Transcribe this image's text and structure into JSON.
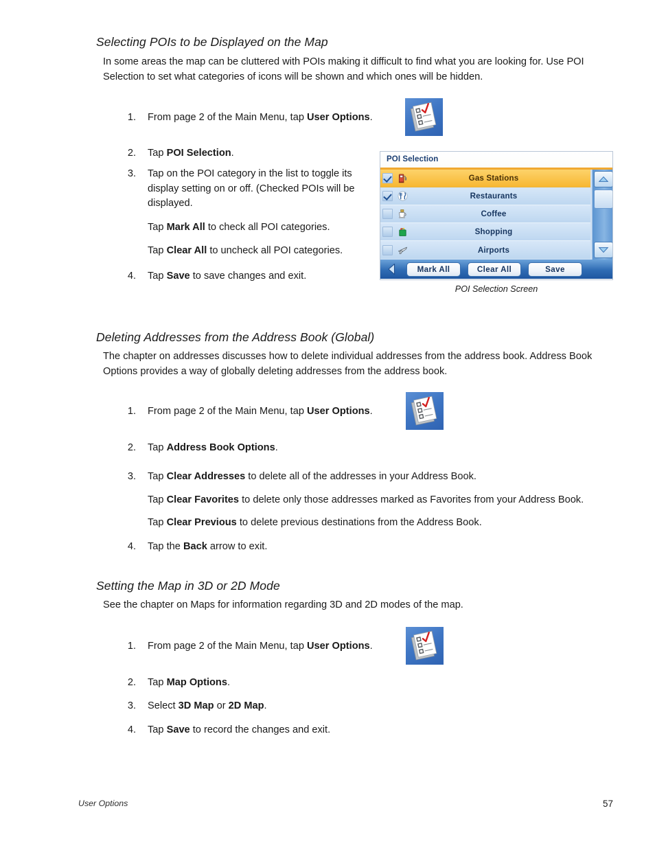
{
  "page": {
    "number": "57",
    "footer_label": "User Options"
  },
  "sections": [
    {
      "heading": "Selecting POIs to be Displayed on the Map",
      "intro": "In some areas the map can be cluttered with POIs making it difficult to find what you are looking for.  Use POI Selection to set what categories of icons will be shown and which ones will be hidden.",
      "steps": {
        "n1": "1.",
        "s1_a": "From page 2 of the Main Menu, tap ",
        "s1_b": "User Options",
        "s1_c": ".",
        "n2": "2.",
        "s2_a": "Tap ",
        "s2_b": "POI Selection",
        "s2_c": ".",
        "n3": "3.",
        "s3_a": "Tap on the POI category in the list to toggle its display setting on or off.  (Checked POIs will be displayed.",
        "s3_sub1_a": "Tap ",
        "s3_sub1_b": "Mark All",
        "s3_sub1_c": " to check all POI categories.",
        "s3_sub2_a": "Tap ",
        "s3_sub2_b": "Clear All",
        "s3_sub2_c": " to uncheck all POI categories.",
        "n4": "4.",
        "s4_a": "Tap ",
        "s4_b": "Save",
        "s4_c": " to save changes and exit."
      }
    },
    {
      "heading": "Deleting Addresses from the Address Book (Global)",
      "intro": "The chapter on addresses discusses how to delete individual addresses from the address book.  Address Book Options provides a way of globally deleting addresses from the address book.",
      "steps": {
        "n1": "1.",
        "s1_a": "From page 2 of the Main Menu, tap ",
        "s1_b": "User Options",
        "s1_c": ".",
        "n2": "2.",
        "s2_a": "Tap ",
        "s2_b": "Address Book Options",
        "s2_c": ".",
        "n3": "3.",
        "s3_a": "Tap ",
        "s3_b": "Clear Addresses",
        "s3_c": " to delete all of the addresses in your Address Book.",
        "s3_sub1_a": "Tap ",
        "s3_sub1_b": "Clear Favorites",
        "s3_sub1_c": " to delete only those addresses marked as Favorites from your Address Book.",
        "s3_sub2_a": "Tap ",
        "s3_sub2_b": "Clear Previous",
        "s3_sub2_c": " to delete previous destinations from the Address Book.",
        "n4": "4.",
        "s4_a": "Tap the ",
        "s4_b": "Back",
        "s4_c": " arrow to exit."
      }
    },
    {
      "heading": "Setting the Map in 3D or 2D Mode",
      "intro": "See the chapter on Maps for information regarding 3D and 2D modes of the map.",
      "steps": {
        "n1": "1.",
        "s1_a": "From page 2 of the Main Menu, tap ",
        "s1_b": "User Options",
        "s1_c": ".",
        "n2": "2.",
        "s2_a": "Tap ",
        "s2_b": "Map Options",
        "s2_c": ".",
        "n3": "3.",
        "s3_a": "Select ",
        "s3_b": "3D Map",
        "s3_mid": " or ",
        "s3_b2": "2D Map",
        "s3_c": ".",
        "n4": "4.",
        "s4_a": "Tap ",
        "s4_b": "Save",
        "s4_c": " to record the changes and exit."
      }
    }
  ],
  "device": {
    "title": "POI Selection",
    "caption": "POI Selection Screen",
    "rows": [
      {
        "label": "Gas Stations",
        "checked": true,
        "selected": true,
        "icon": "gas-pump-icon"
      },
      {
        "label": "Restaurants",
        "checked": true,
        "selected": false,
        "icon": "restaurant-icon"
      },
      {
        "label": "Coffee",
        "checked": false,
        "selected": false,
        "icon": "coffee-cup-icon"
      },
      {
        "label": "Shopping",
        "checked": false,
        "selected": false,
        "icon": "shopping-bag-icon"
      },
      {
        "label": "Airports",
        "checked": false,
        "selected": false,
        "icon": "airplane-icon"
      }
    ],
    "buttons": {
      "mark_all": "Mark All",
      "clear_all": "Clear All",
      "save": "Save"
    },
    "colors": {
      "selected_row": "#f7b733",
      "row": "#c8def4",
      "title_accent": "#f0a830",
      "bar": "#2f6cb4",
      "label_text": "#16355f"
    }
  }
}
